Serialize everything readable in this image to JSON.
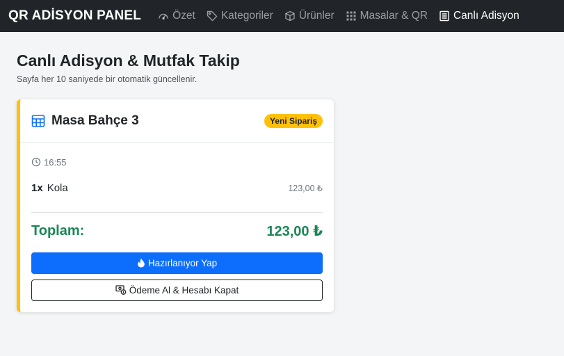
{
  "navbar": {
    "brand": "QR ADİSYON PANEL",
    "items": [
      {
        "label": "Özet",
        "icon": "speedometer-icon",
        "active": false
      },
      {
        "label": "Kategoriler",
        "icon": "tags-icon",
        "active": false
      },
      {
        "label": "Ürünler",
        "icon": "box-icon",
        "active": false
      },
      {
        "label": "Masalar & QR",
        "icon": "grid-icon",
        "active": false
      },
      {
        "label": "Canlı Adisyon",
        "icon": "receipt-icon",
        "active": true
      }
    ]
  },
  "page": {
    "title": "Canlı Adisyon & Mutfak Takip",
    "subtitle": "Sayfa her 10 saniyede bir otomatik güncellenir."
  },
  "order": {
    "table_name": "Masa Bahçe 3",
    "table_icon": "table-icon",
    "status_badge": "Yeni Sipariş",
    "time": "16:55",
    "items": [
      {
        "qty": "1x",
        "name": "Kola",
        "price": "123,00 ₺"
      }
    ],
    "total_label": "Toplam:",
    "total_value": "123,00 ₺",
    "primary_action": "Hazırlanıyor Yap",
    "secondary_action": "Ödeme Al & Hesabı Kapat"
  },
  "colors": {
    "navbar_bg": "#212529",
    "accent_warning": "#ffc107",
    "primary": "#0d6efd",
    "success": "#198754"
  }
}
